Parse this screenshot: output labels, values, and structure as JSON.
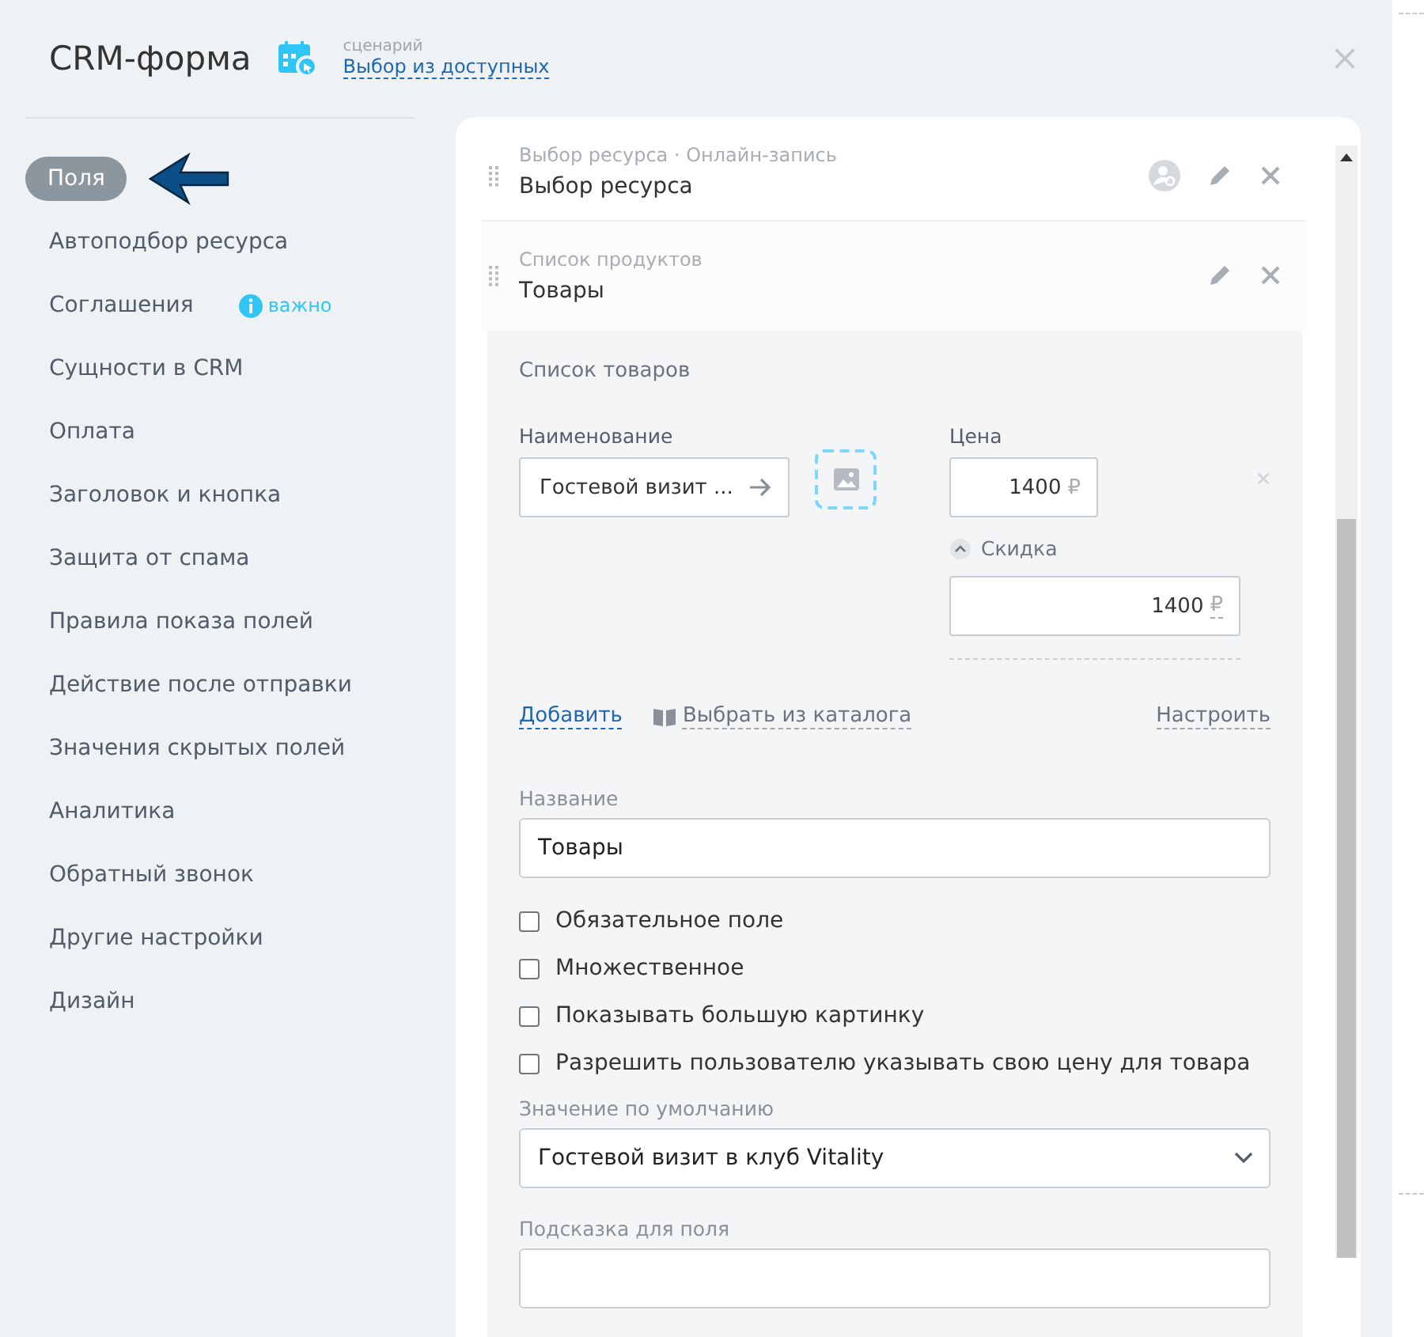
{
  "header": {
    "title": "CRM-форма",
    "scenario_label": "сценарий",
    "scenario_link": "Выбор из доступных"
  },
  "sidebar": {
    "items": [
      {
        "label": "Поля",
        "selected": true
      },
      {
        "label": "Автоподбор ресурса",
        "selected": false
      },
      {
        "label": "Соглашения",
        "selected": false,
        "badge": "важно"
      },
      {
        "label": "Сущности в CRM",
        "selected": false
      },
      {
        "label": "Оплата",
        "selected": false
      },
      {
        "label": "Заголовок и кнопка",
        "selected": false
      },
      {
        "label": "Защита от спама",
        "selected": false
      },
      {
        "label": "Правила показа полей",
        "selected": false
      },
      {
        "label": "Действие после отправки",
        "selected": false
      },
      {
        "label": "Значения скрытых полей",
        "selected": false
      },
      {
        "label": "Аналитика",
        "selected": false
      },
      {
        "label": "Обратный звонок",
        "selected": false
      },
      {
        "label": "Другие настройки",
        "selected": false
      },
      {
        "label": "Дизайн",
        "selected": false
      }
    ]
  },
  "fields": [
    {
      "kind": "resource",
      "subtitle": "Выбор ресурса · Онлайн-запись",
      "title": "Выбор ресурса"
    },
    {
      "kind": "products",
      "subtitle": "Список продуктов",
      "title": "Товары"
    }
  ],
  "editor": {
    "section_title": "Список товаров",
    "name_label": "Наименование",
    "name_value": "Гостевой визит ...",
    "price_label": "Цена",
    "price_value": "1400",
    "currency": "₽",
    "discount_label": "Скидка",
    "discount_value": "1400",
    "discount_currency": "₽",
    "add": "Добавить",
    "catalog": "Выбрать из каталога",
    "configure": "Настроить",
    "title_label": "Название",
    "title_value": "Товары",
    "options": [
      {
        "label": "Обязательное поле",
        "checked": false
      },
      {
        "label": "Множественное",
        "checked": false
      },
      {
        "label": "Показывать большую картинку",
        "checked": false
      },
      {
        "label": "Разрешить пользователю указывать свою цену для товара",
        "checked": false
      }
    ],
    "default_label": "Значение по умолчанию",
    "default_value": "Гостевой визит в клуб Vitality",
    "hint_label": "Подсказка для поля"
  }
}
